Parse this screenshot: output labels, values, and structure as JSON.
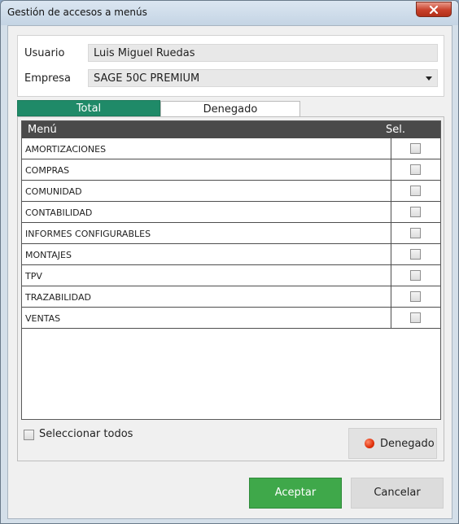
{
  "window": {
    "title": "Gestión de accesos a menús"
  },
  "form": {
    "usuario_label": "Usuario",
    "usuario_value": "Luis Miguel Ruedas",
    "empresa_label": "Empresa",
    "empresa_value": "SAGE 50C PREMIUM"
  },
  "tabs": [
    {
      "label": "Total",
      "active": true
    },
    {
      "label": "Denegado",
      "active": false
    }
  ],
  "grid": {
    "col_menu": "Menú",
    "col_sel": "Sel.",
    "rows": [
      {
        "name": "AMORTIZACIONES",
        "checked": false
      },
      {
        "name": "COMPRAS",
        "checked": false
      },
      {
        "name": "COMUNIDAD",
        "checked": false
      },
      {
        "name": "CONTABILIDAD",
        "checked": false
      },
      {
        "name": "INFORMES CONFIGURABLES",
        "checked": false
      },
      {
        "name": "MONTAJES",
        "checked": false
      },
      {
        "name": "TPV",
        "checked": false
      },
      {
        "name": "TRAZABILIDAD",
        "checked": false
      },
      {
        "name": "VENTAS",
        "checked": false
      }
    ]
  },
  "select_all_label": "Seleccionar todos",
  "buttons": {
    "denegado": "Denegado",
    "accept": "Aceptar",
    "cancel": "Cancelar"
  },
  "colors": {
    "tab_active": "#1f8a68",
    "accept": "#3fa84a",
    "grid_header": "#4a4a4a",
    "denied_dot": "#e0300a"
  }
}
